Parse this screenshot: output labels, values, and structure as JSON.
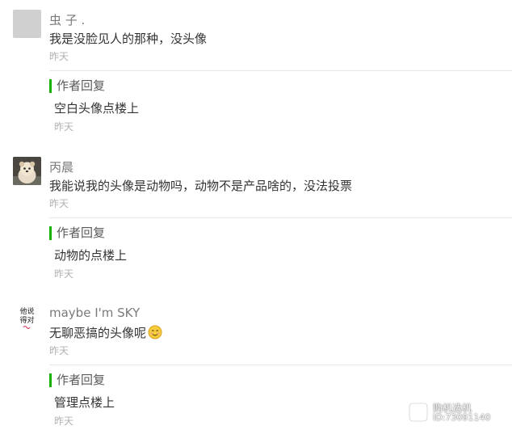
{
  "colors": {
    "accent_green": "#18b100",
    "nickname": "#7a7a7a",
    "meta": "#b2b2b2",
    "divider": "#e7e7e7"
  },
  "comments": [
    {
      "avatar_icon": "blank-avatar-icon",
      "nickname": "虫 子 .",
      "content": "我是没脸见人的那种，没头像",
      "time": "昨天",
      "reply": {
        "label": "作者回复",
        "content": "空白头像点楼上",
        "time": "昨天"
      }
    },
    {
      "avatar_icon": "dog-avatar-icon",
      "nickname": "丙晨",
      "content": "我能说我的头像是动物吗，动物不是产品啥的，没法投票",
      "time": "昨天",
      "reply": {
        "label": "作者回复",
        "content": "动物的点楼上",
        "time": "昨天"
      }
    },
    {
      "avatar_icon": "text-avatar-icon",
      "avatar_text": [
        "他说",
        "得对"
      ],
      "nickname": "maybe I'm SKY",
      "content": "无聊恶搞的头像呢",
      "content_emoji": "smiling-emoji-icon",
      "time": "昨天",
      "reply": {
        "label": "作者回复",
        "content": "管理点楼上",
        "time": "昨天"
      }
    }
  ],
  "watermark": {
    "name": "购机选机",
    "id": "ID:73091140"
  }
}
